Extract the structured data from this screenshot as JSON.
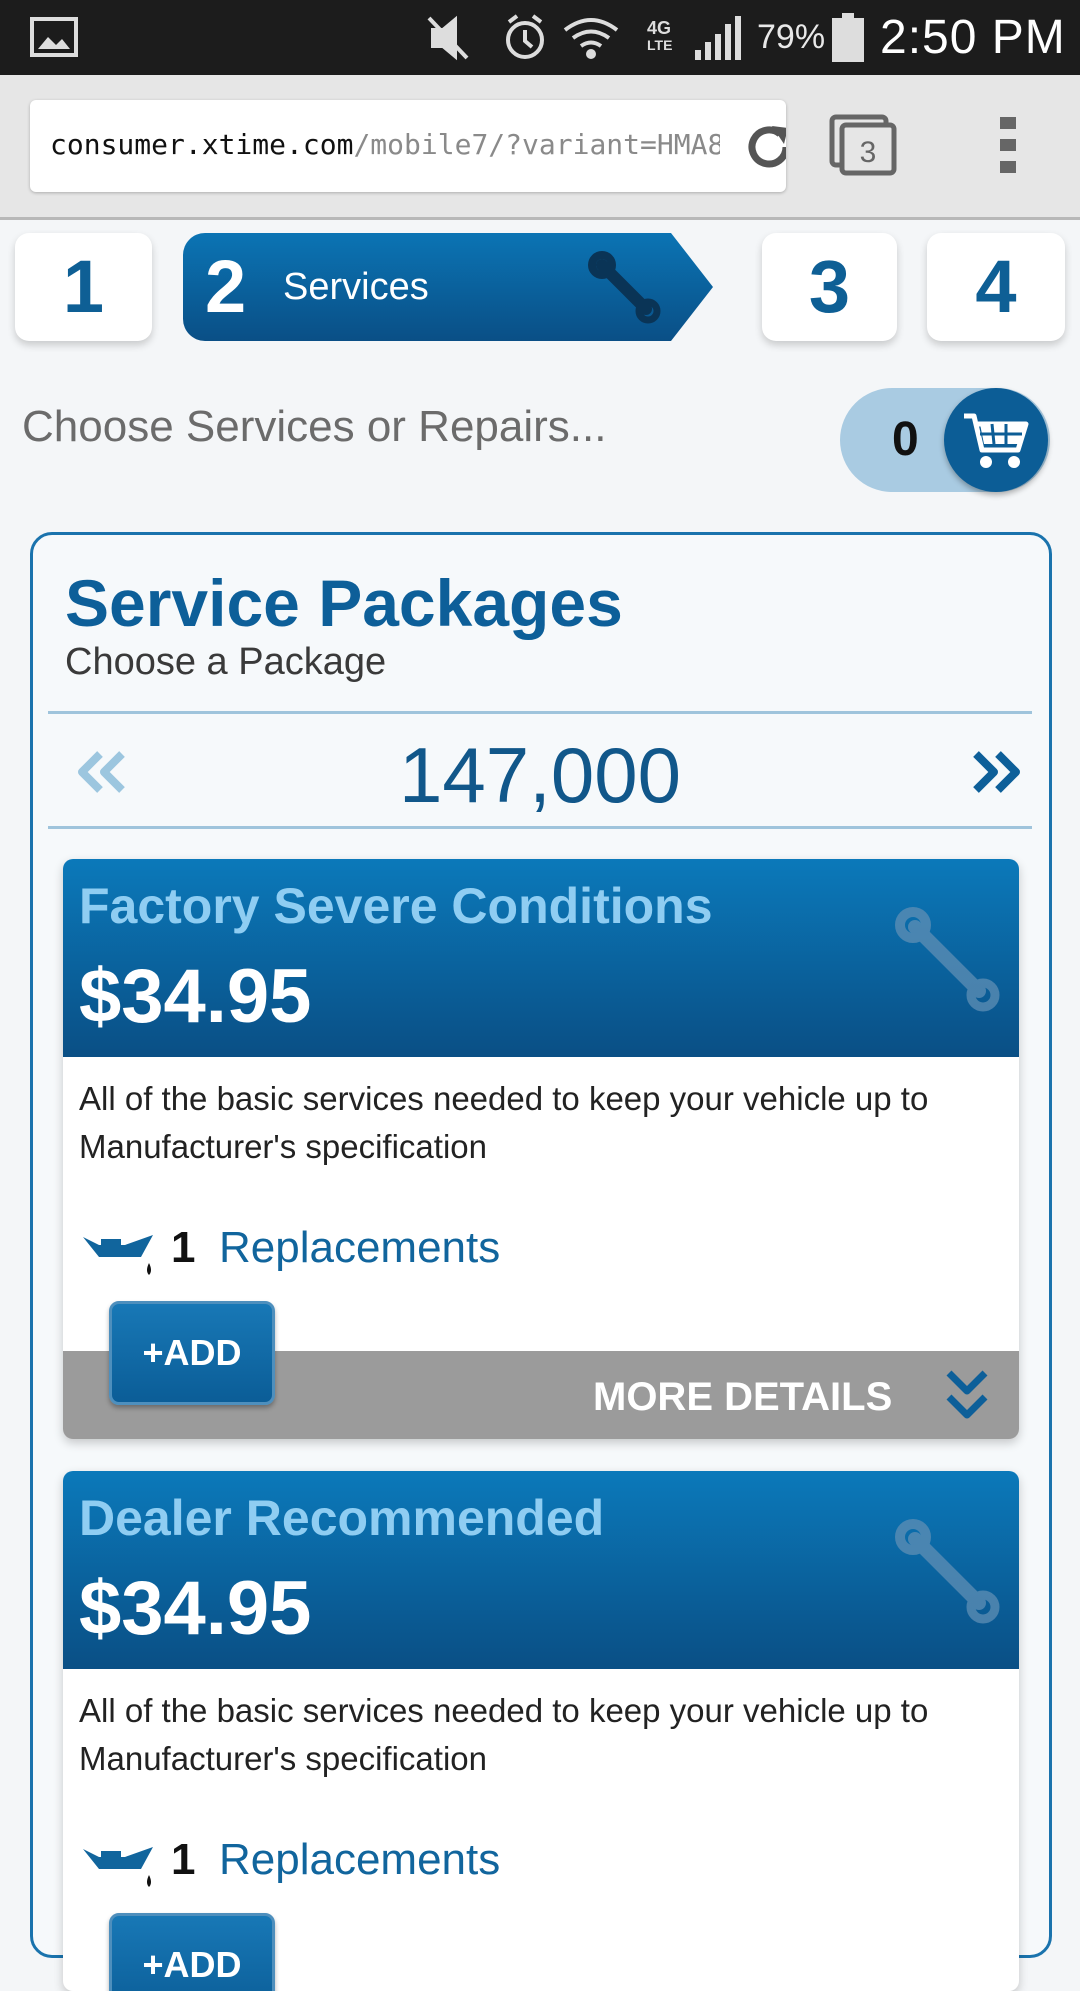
{
  "status_bar": {
    "battery": "79%",
    "time": "2:50 PM"
  },
  "browser": {
    "url_host": "consumer.xtime.com",
    "url_path": "/mobile7/?variant=HMA8",
    "tab_count": "3"
  },
  "steps": {
    "step1": "1",
    "step2": "2",
    "step2_label": "Services",
    "step3": "3",
    "step4": "4"
  },
  "prompt": "Choose Services or Repairs...",
  "cart": {
    "count": "0"
  },
  "packages": {
    "title": "Service Packages",
    "subtitle": "Choose a Package",
    "mileage": "147,000",
    "items": [
      {
        "name": "Factory Severe Conditions",
        "price": "$34.95",
        "description": "All of the basic services needed to keep your vehicle up to Manufacturer's specification",
        "replacement_count": "1",
        "replacement_label": "Replacements",
        "add_label": "+ADD",
        "more_label": "MORE DETAILS"
      },
      {
        "name": "Dealer Recommended",
        "price": "$34.95",
        "description": "All of the basic services needed to keep your vehicle up to Manufacturer's specification",
        "replacement_count": "1",
        "replacement_label": "Replacements",
        "add_label": "+ADD"
      }
    ]
  },
  "colors": {
    "brand_blue": "#0c5d96",
    "accent_light_blue": "#8fcdf2",
    "cart_bg": "#a9cbe2"
  }
}
